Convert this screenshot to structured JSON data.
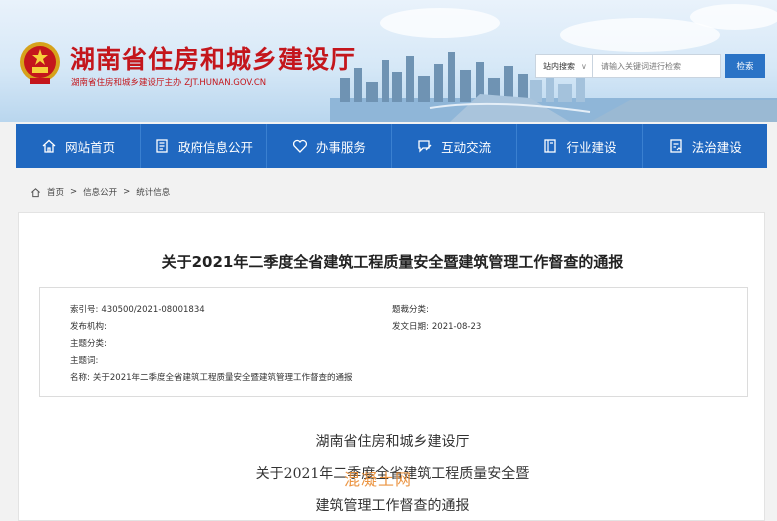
{
  "header": {
    "site_title": "湖南省住房和城乡建设厅",
    "site_subtitle": "湖南省住房和城乡建设厅主办  ZJT.HUNAN.GOV.CN",
    "search": {
      "scope": "站内搜索",
      "placeholder": "请输入关键词进行检索",
      "button": "检索"
    },
    "emblem_icon": "national-emblem-icon"
  },
  "nav": {
    "items": [
      {
        "label": "网站首页",
        "icon": "home-icon"
      },
      {
        "label": "政府信息公开",
        "icon": "document-icon"
      },
      {
        "label": "办事服务",
        "icon": "heart-icon"
      },
      {
        "label": "互动交流",
        "icon": "chat-edit-icon"
      },
      {
        "label": "行业建设",
        "icon": "book-icon"
      },
      {
        "label": "法治建设",
        "icon": "legal-doc-icon"
      }
    ],
    "color": "#2068c0"
  },
  "breadcrumb": {
    "items": [
      "首页",
      "信息公开",
      "统计信息"
    ],
    "separator": ">"
  },
  "article": {
    "title": "关于2021年二季度全省建筑工程质量安全暨建筑管理工作督查的通报",
    "meta": {
      "index_label": "索引号:",
      "index_value": "430500/2021-08001834",
      "topic_label": "题裁分类:",
      "topic_value": "",
      "org_label": "发布机构:",
      "org_value": "",
      "date_label": "发文日期:",
      "date_value": "2021-08-23",
      "subject_label": "主题分类:",
      "subject_value": "",
      "keywords_label": "主题词:",
      "keywords_value": "",
      "name_label": "名称:",
      "name_value": "关于2021年二季度全省建筑工程质量安全暨建筑管理工作督查的通报"
    },
    "body": {
      "issuer": "湖南省住房和城乡建设厅",
      "heading_line1": "关于2021年二季度全省建筑工程质量安全暨",
      "heading_line2": "建筑管理工作督查的通报"
    }
  },
  "watermark": "混凝土网",
  "colors": {
    "title_red": "#c4161c",
    "nav_blue": "#2068c0",
    "search_button": "#2a73c6",
    "watermark": "#e98a2f"
  }
}
